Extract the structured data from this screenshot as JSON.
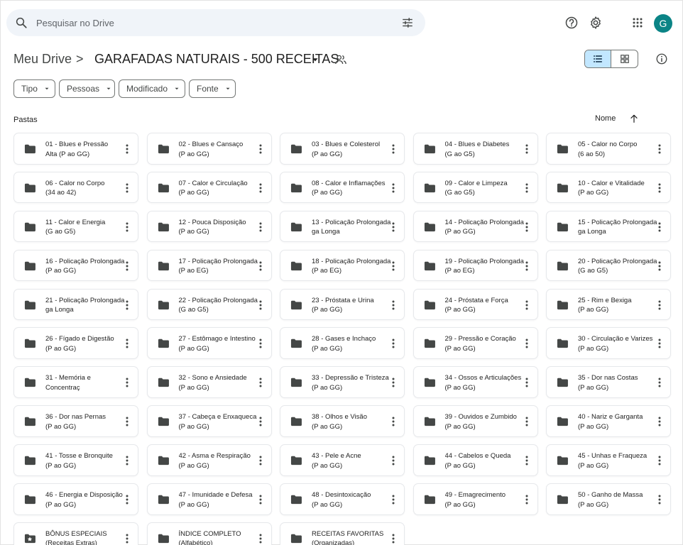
{
  "search": {
    "placeholder": "Pesquisar no Drive"
  },
  "avatar": {
    "initial": "G",
    "color": "#0b8486"
  },
  "breadcrumb": {
    "root": "Meu Drive",
    "separator": ">",
    "current": "GARAFADAS NATURAIS - 500 RECEITAS"
  },
  "filters": [
    {
      "label": "Tipo"
    },
    {
      "label": "Pessoas"
    },
    {
      "label": "Modificado"
    },
    {
      "label": "Fonte"
    }
  ],
  "section": {
    "label": "Pastas"
  },
  "sort": {
    "label": "Nome"
  },
  "folders": [
    {
      "line1": "01 - Blues e Pressão",
      "line2": "Alta (P ao GG)",
      "icon": "folder-icon"
    },
    {
      "line1": "02 - Blues e Cansaço",
      "line2": "(P ao GG)",
      "icon": "folder-icon"
    },
    {
      "line1": "03 - Blues e Colesterol",
      "line2": "(P ao GG)",
      "icon": "folder-icon"
    },
    {
      "line1": "04 - Blues e Diabetes",
      "line2": "(G ao G5)",
      "icon": "folder-icon"
    },
    {
      "line1": "05 - Calor no Corpo",
      "line2": "(6 ao 50)",
      "icon": "folder-icon"
    },
    {
      "line1": "06 - Calor no Corpo",
      "line2": "(34 ao 42)",
      "icon": "folder-icon"
    },
    {
      "line1": "07 - Calor e Circulação",
      "line2": "(P ao GG)",
      "icon": "folder-icon"
    },
    {
      "line1": "08 - Calor e Inflamações",
      "line2": "(P ao GG)",
      "icon": "folder-icon"
    },
    {
      "line1": "09 - Calor e Limpeza",
      "line2": "(G ao G5)",
      "icon": "folder-icon"
    },
    {
      "line1": "10 - Calor e Vitalidade",
      "line2": "(P ao GG)",
      "icon": "folder-icon"
    },
    {
      "line1": "11 - Calor e Energia",
      "line2": "(G ao G5)",
      "icon": "folder-icon"
    },
    {
      "line1": "12 - Pouca Disposição",
      "line2": "(P ao GG)",
      "icon": "folder-icon"
    },
    {
      "line1": "13 - Policação Prolongada",
      "line2": "ga Longa",
      "icon": "folder-icon"
    },
    {
      "line1": "14 - Policação Prolongada",
      "line2": "(P ao GG)",
      "icon": "folder-icon"
    },
    {
      "line1": "15 - Policação Prolongada",
      "line2": "ga Longa",
      "icon": "folder-icon"
    },
    {
      "line1": "16 - Policação Prolongada",
      "line2": "(P ao GG)",
      "icon": "folder-icon"
    },
    {
      "line1": "17 - Policação Prolongada",
      "line2": "(P ao EG)",
      "icon": "folder-icon"
    },
    {
      "line1": "18 - Policação Prolongada",
      "line2": "(P ao EG)",
      "icon": "folder-icon"
    },
    {
      "line1": "19 - Policação Prolongada",
      "line2": "(P ao EG)",
      "icon": "folder-icon"
    },
    {
      "line1": "20 - Policação Prolongada",
      "line2": "(G ao G5)",
      "icon": "folder-icon"
    },
    {
      "line1": "21 - Policação Prolongada",
      "line2": "ga Longa",
      "icon": "folder-icon"
    },
    {
      "line1": "22 - Policação Prolongada",
      "line2": "(G ao G5)",
      "icon": "folder-icon"
    },
    {
      "line1": "23 - Próstata e Urina",
      "line2": "(P ao GG)",
      "icon": "folder-icon"
    },
    {
      "line1": "24 - Próstata e Força",
      "line2": "(P ao GG)",
      "icon": "folder-icon"
    },
    {
      "line1": "25 - Rim e Bexiga",
      "line2": "(P ao GG)",
      "icon": "folder-icon"
    },
    {
      "line1": "26 - Fígado e Digestão",
      "line2": "(P ao GG)",
      "icon": "folder-icon"
    },
    {
      "line1": "27 - Estômago e Intestino",
      "line2": "(P ao GG)",
      "icon": "folder-icon"
    },
    {
      "line1": "28 - Gases e Inchaço",
      "line2": "(P ao GG)",
      "icon": "folder-icon"
    },
    {
      "line1": "29 - Pressão e Coração",
      "line2": "(P ao GG)",
      "icon": "folder-icon"
    },
    {
      "line1": "30 - Circulação e Varizes",
      "line2": "(P ao GG)",
      "icon": "folder-icon"
    },
    {
      "line1": "31 - Memória e Concentraç",
      "line2": "(P ao GG)",
      "icon": "folder-icon"
    },
    {
      "line1": "32 - Sono e Ansiedade",
      "line2": "(P ao GG)",
      "icon": "folder-icon"
    },
    {
      "line1": "33 - Depressão e Tristeza",
      "line2": "(P ao GG)",
      "icon": "folder-icon"
    },
    {
      "line1": "34 - Ossos e Articulações",
      "line2": "(P ao GG)",
      "icon": "folder-icon"
    },
    {
      "line1": "35 - Dor nas Costas",
      "line2": "(P ao GG)",
      "icon": "folder-icon"
    },
    {
      "line1": "36 - Dor nas Pernas",
      "line2": "(P ao GG)",
      "icon": "folder-icon"
    },
    {
      "line1": "37 - Cabeça e Enxaqueca",
      "line2": "(P ao GG)",
      "icon": "folder-icon"
    },
    {
      "line1": "38 - Olhos e Visão",
      "line2": "(P ao GG)",
      "icon": "folder-icon"
    },
    {
      "line1": "39 - Ouvidos e Zumbido",
      "line2": "(P ao GG)",
      "icon": "folder-icon"
    },
    {
      "line1": "40 - Nariz e Garganta",
      "line2": "(P ao GG)",
      "icon": "folder-icon"
    },
    {
      "line1": "41 - Tosse e Bronquite",
      "line2": "(P ao GG)",
      "icon": "folder-icon"
    },
    {
      "line1": "42 - Asma e Respiração",
      "line2": "(P ao GG)",
      "icon": "folder-icon"
    },
    {
      "line1": "43 - Pele e Acne",
      "line2": "(P ao GG)",
      "icon": "folder-icon"
    },
    {
      "line1": "44 - Cabelos e Queda",
      "line2": "(P ao GG)",
      "icon": "folder-icon"
    },
    {
      "line1": "45 - Unhas e Fraqueza",
      "line2": "(P ao GG)",
      "icon": "folder-icon"
    },
    {
      "line1": "46 - Energia e Disposição",
      "line2": "(P ao GG)",
      "icon": "folder-icon"
    },
    {
      "line1": "47 - Imunidade e Defesa",
      "line2": "(P ao GG)",
      "icon": "folder-icon"
    },
    {
      "line1": "48 - Desintoxicação",
      "line2": "(P ao GG)",
      "icon": "folder-icon"
    },
    {
      "line1": "49 - Emagrecimento",
      "line2": "(P ao GG)",
      "icon": "folder-icon"
    },
    {
      "line1": "50 - Ganho de Massa",
      "line2": "(P ao GG)",
      "icon": "folder-icon"
    },
    {
      "line1": "BÔNUS ESPECIAIS",
      "line2": "(Receitas Extras)",
      "icon": "starred-folder-icon"
    },
    {
      "line1": "ÍNDICE COMPLETO",
      "line2": "(Alfabético)",
      "icon": "folder-icon"
    },
    {
      "line1": "RECEITAS FAVORITAS",
      "line2": "(Organizadas)",
      "icon": "folder-icon"
    }
  ],
  "colors": {
    "search_bg": "#f0f4f9",
    "active_view": "#c2e7ff",
    "icon_dark": "#444746"
  }
}
